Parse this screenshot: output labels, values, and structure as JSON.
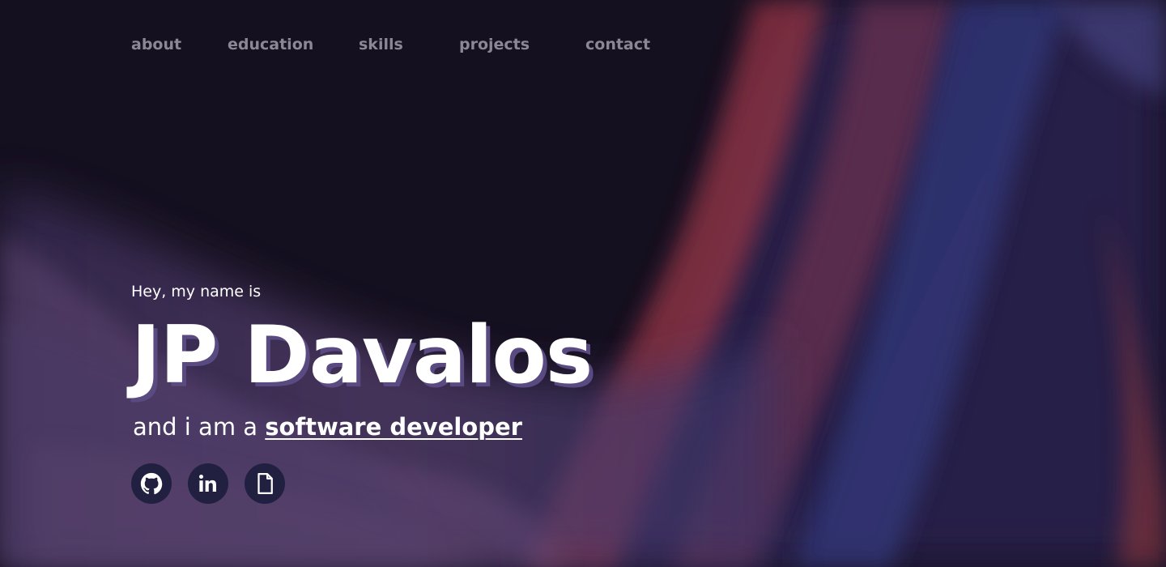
{
  "nav": {
    "items": [
      {
        "label": "about"
      },
      {
        "label": "education"
      },
      {
        "label": "skills"
      },
      {
        "label": "projects"
      },
      {
        "label": "contact"
      }
    ]
  },
  "hero": {
    "greeting": "Hey, my name is",
    "name": "JP Davalos",
    "tagline_prefix": "and i am a ",
    "role": "software developer"
  },
  "socials": [
    {
      "icon": "github-icon"
    },
    {
      "icon": "linkedin-icon"
    },
    {
      "icon": "resume-document-icon"
    }
  ],
  "colors": {
    "background": "#15101f",
    "nav_text": "#8b8794",
    "text": "#ffffff",
    "name_shadow": "#5a4a82",
    "social_circle": "#212040"
  }
}
